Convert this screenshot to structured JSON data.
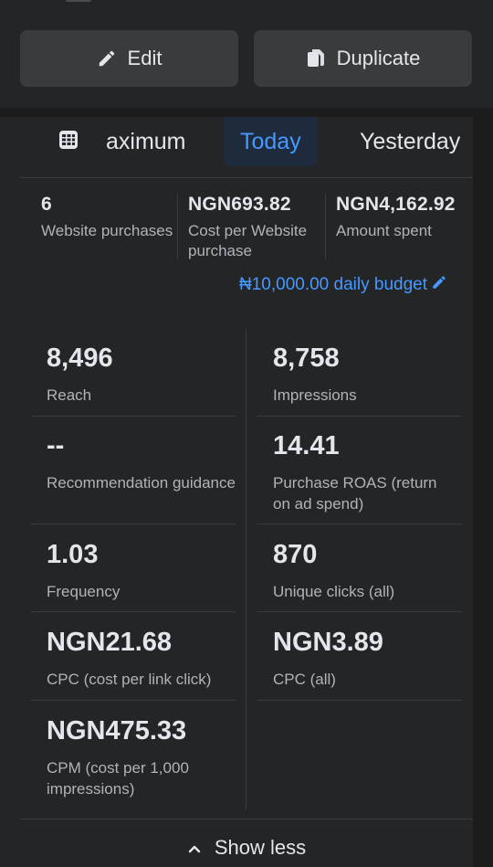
{
  "actions": {
    "edit_label": "Edit",
    "duplicate_label": "Duplicate"
  },
  "date_tabs": {
    "icon": "table-grid-icon",
    "items": [
      "aximum",
      "Today",
      "Yesterday"
    ],
    "selected": "Today"
  },
  "summary": [
    {
      "value": "6",
      "label": "Website purchases"
    },
    {
      "value": "NGN693.82",
      "label": "Cost per Website purchase"
    },
    {
      "value": "NGN4,162.92",
      "label": "Amount spent"
    }
  ],
  "budget": {
    "text": "₦10,000.00 daily budget",
    "icon": "pencil-icon"
  },
  "metrics": [
    {
      "value": "8,496",
      "label": "Reach"
    },
    {
      "value": "8,758",
      "label": "Impressions"
    },
    {
      "value": "--",
      "label": "Recommendation guidance"
    },
    {
      "value": "14.41",
      "label": "Purchase ROAS (return on ad spend)"
    },
    {
      "value": "1.03",
      "label": "Frequency"
    },
    {
      "value": "870",
      "label": "Unique clicks (all)"
    },
    {
      "value": "NGN21.68",
      "label": "CPC (cost per link click)"
    },
    {
      "value": "NGN3.89",
      "label": "CPC (all)"
    },
    {
      "value": "NGN475.33",
      "label": "CPM (cost per 1,000 impressions)"
    }
  ],
  "footer": {
    "show_less_label": "Show less",
    "icon": "chevron-up-icon"
  },
  "colors": {
    "background": "#1c1c1d",
    "panel": "#242526",
    "button": "#3a3b3c",
    "accent": "#4599ff",
    "text_primary": "#e4e6eb",
    "text_secondary": "#b0b3b8"
  }
}
